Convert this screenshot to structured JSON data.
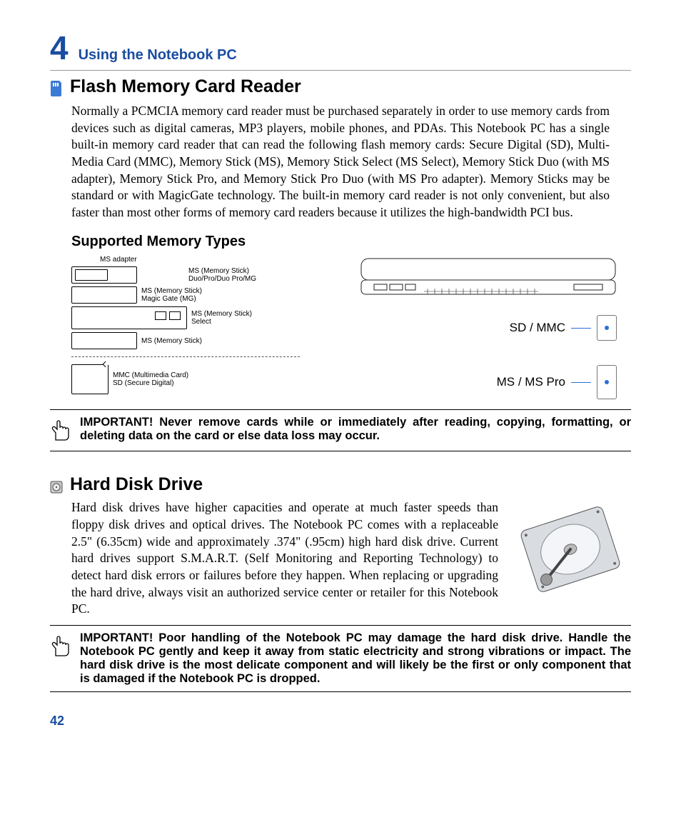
{
  "chapter": {
    "number": "4",
    "title": "Using the Notebook PC"
  },
  "section1": {
    "title": "Flash Memory Card Reader",
    "body": "Normally a PCMCIA memory card reader must be purchased separately in order to use memory cards from devices such as digital cameras, MP3 players, mobile phones, and PDAs. This Notebook PC has a single built-in memory card reader that can read the following flash memory cards: Secure Digital (SD), Multi-Media Card (MMC), Memory Stick (MS), Memory Stick Select (MS Select), Memory Stick Duo (with MS adapter), Memory Stick Pro, and Memory Stick Pro Duo (with MS Pro adapter). Memory Sticks may be standard or with MagicGate technology. The built-in memory card reader is not only convenient, but also faster than most other forms of memory card readers because it utilizes the high-bandwidth PCI bus."
  },
  "memtypes": {
    "heading": "Supported Memory Types",
    "adapter_label": "MS adapter",
    "row1": "MS (Memory Stick)\nDuo/Pro/Duo Pro/MG",
    "row2": "MS (Memory Stick)\nMagic Gate (MG)",
    "row3": "MS (Memory Stick)\nSelect",
    "row4": "MS (Memory Stick)",
    "row5": "MMC (Multimedia Card)\nSD (Secure Digital)",
    "slot_sd": "SD / MMC",
    "slot_ms": "MS / MS Pro"
  },
  "note1": "IMPORTANT!  Never remove cards while or immediately after reading, copying, formatting, or deleting data on the card or else data loss may occur.",
  "section2": {
    "title": "Hard Disk Drive",
    "body": "Hard disk drives have higher capacities and operate at much faster speeds than floppy disk drives and optical drives. The Notebook PC comes with a replaceable 2.5\" (6.35cm) wide and approximately .374\" (.95cm) high hard disk drive. Current hard drives support S.M.A.R.T. (Self Monitoring and Reporting Technology) to detect hard disk errors or failures before they happen. When replacing or upgrading the hard drive, always visit an authorized service center or retailer for this Notebook PC."
  },
  "note2": "IMPORTANT!  Poor handling of the Notebook PC may damage the hard disk drive. Handle the Notebook PC gently and keep it away from static electricity and strong vibrations or impact. The hard disk drive is the most delicate component and will likely be the first or only component that is damaged if the Notebook PC is dropped.",
  "page_number": "42"
}
